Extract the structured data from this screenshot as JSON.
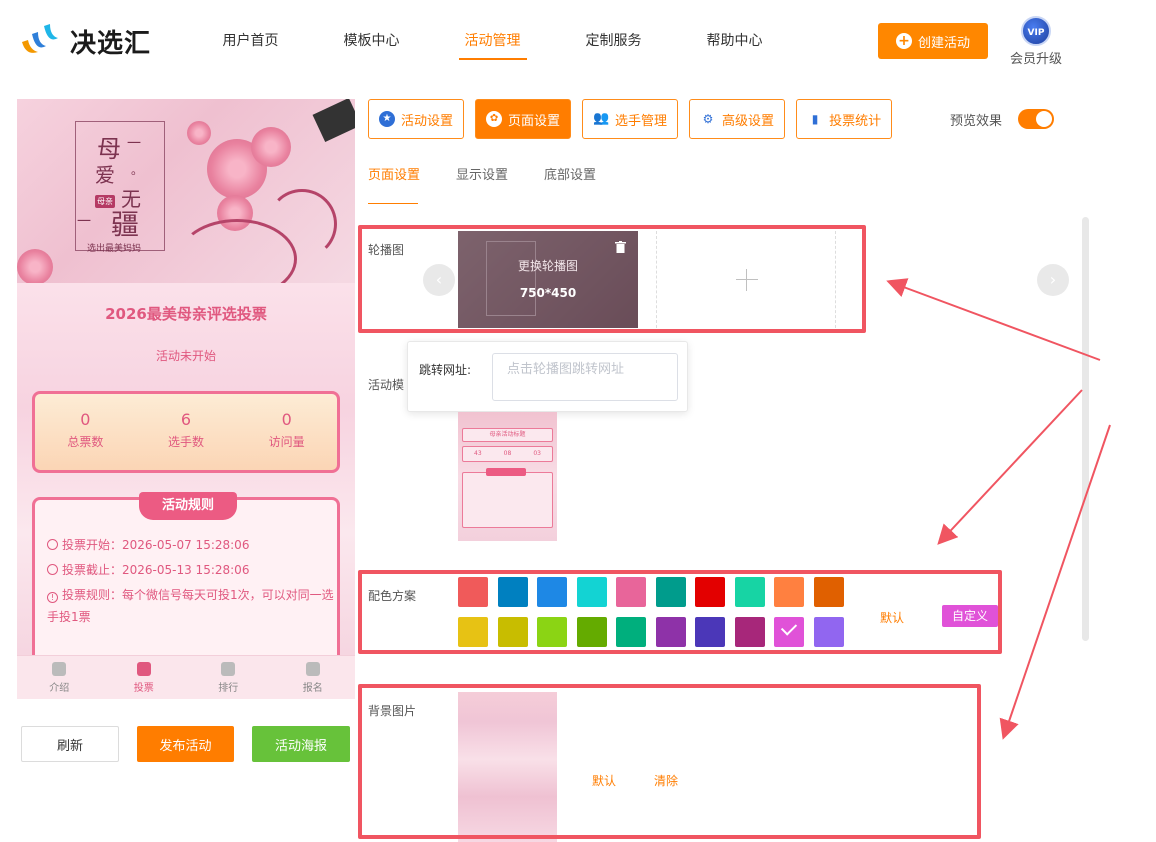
{
  "app": {
    "brand": "决选汇",
    "nav": [
      "用户首页",
      "模板中心",
      "活动管理",
      "定制服务",
      "帮助中心"
    ],
    "active_nav": "活动管理",
    "create_button": "创建活动",
    "vip_badge": "VIP",
    "vip_label": "会员升级"
  },
  "preview": {
    "banner_chars": [
      "母",
      "爱",
      "无",
      "疆",
      "一",
      "一",
      "。"
    ],
    "banner_seal": "母亲",
    "banner_subtitle": "选出最美妈妈",
    "title": "2026最美母亲评选投票",
    "status": "活动未开始",
    "stats": [
      {
        "num": "0",
        "label": "总票数"
      },
      {
        "num": "6",
        "label": "选手数"
      },
      {
        "num": "0",
        "label": "访问量"
      }
    ],
    "rules_title": "活动规则",
    "rules": [
      "投票开始：2026-05-07 15:28:06",
      "投票截止：2026-05-13 15:28:06",
      "投票规则：每个微信号每天可投1次，可以对同一选手投1票"
    ],
    "tabbar": [
      "介绍",
      "投票",
      "排行",
      "报名"
    ],
    "active_tab": "投票"
  },
  "actions": {
    "refresh": "刷新",
    "publish": "发布活动",
    "poster": "活动海报"
  },
  "settings": {
    "tabs": [
      {
        "label": "活动设置",
        "icon": "star-icon"
      },
      {
        "label": "页面设置",
        "icon": "gear-icon"
      },
      {
        "label": "选手管理",
        "icon": "users-icon"
      },
      {
        "label": "高级设置",
        "icon": "advanced-icon"
      },
      {
        "label": "投票统计",
        "icon": "bar-chart-icon"
      }
    ],
    "active_tab": "页面设置",
    "preview_label": "预览效果",
    "preview_on": true,
    "sub_tabs": [
      "页面设置",
      "显示设置",
      "底部设置"
    ],
    "active_sub_tab": "页面设置"
  },
  "carousel": {
    "label": "轮播图",
    "replace_text": "更换轮播图",
    "size_text": "750*450",
    "add_icon": "plus-icon",
    "url_label": "跳转网址:",
    "url_placeholder": "点击轮播图跳转网址",
    "url_value": ""
  },
  "template": {
    "label": "活动模",
    "thumb_title": "母亲活动标题",
    "thumb_stats": [
      "43",
      "08",
      "03"
    ]
  },
  "colors": {
    "label": "配色方案",
    "swatches_row1": [
      "#f05a5a",
      "#0080c0",
      "#1e88e5",
      "#13d3d3",
      "#e8659a",
      "#009c8c",
      "#e30000",
      "#17d4a4",
      "#ff8040",
      "#e06000"
    ],
    "swatches_row2": [
      "#e7c214",
      "#c8bd00",
      "#8bd414",
      "#64ab00",
      "#00af7d",
      "#8e32a8",
      "#4b37b8",
      "#a7277a",
      "#e052d8",
      "#9166f0"
    ],
    "selected": "#e052d8",
    "default_label": "默认",
    "custom_label": "自定义"
  },
  "background": {
    "label": "背景图片",
    "default_label": "默认",
    "clear_label": "清除"
  },
  "theme": {
    "accent": "#ff7d00",
    "annotation_red": "#f05561",
    "pink": "#e0587f"
  }
}
